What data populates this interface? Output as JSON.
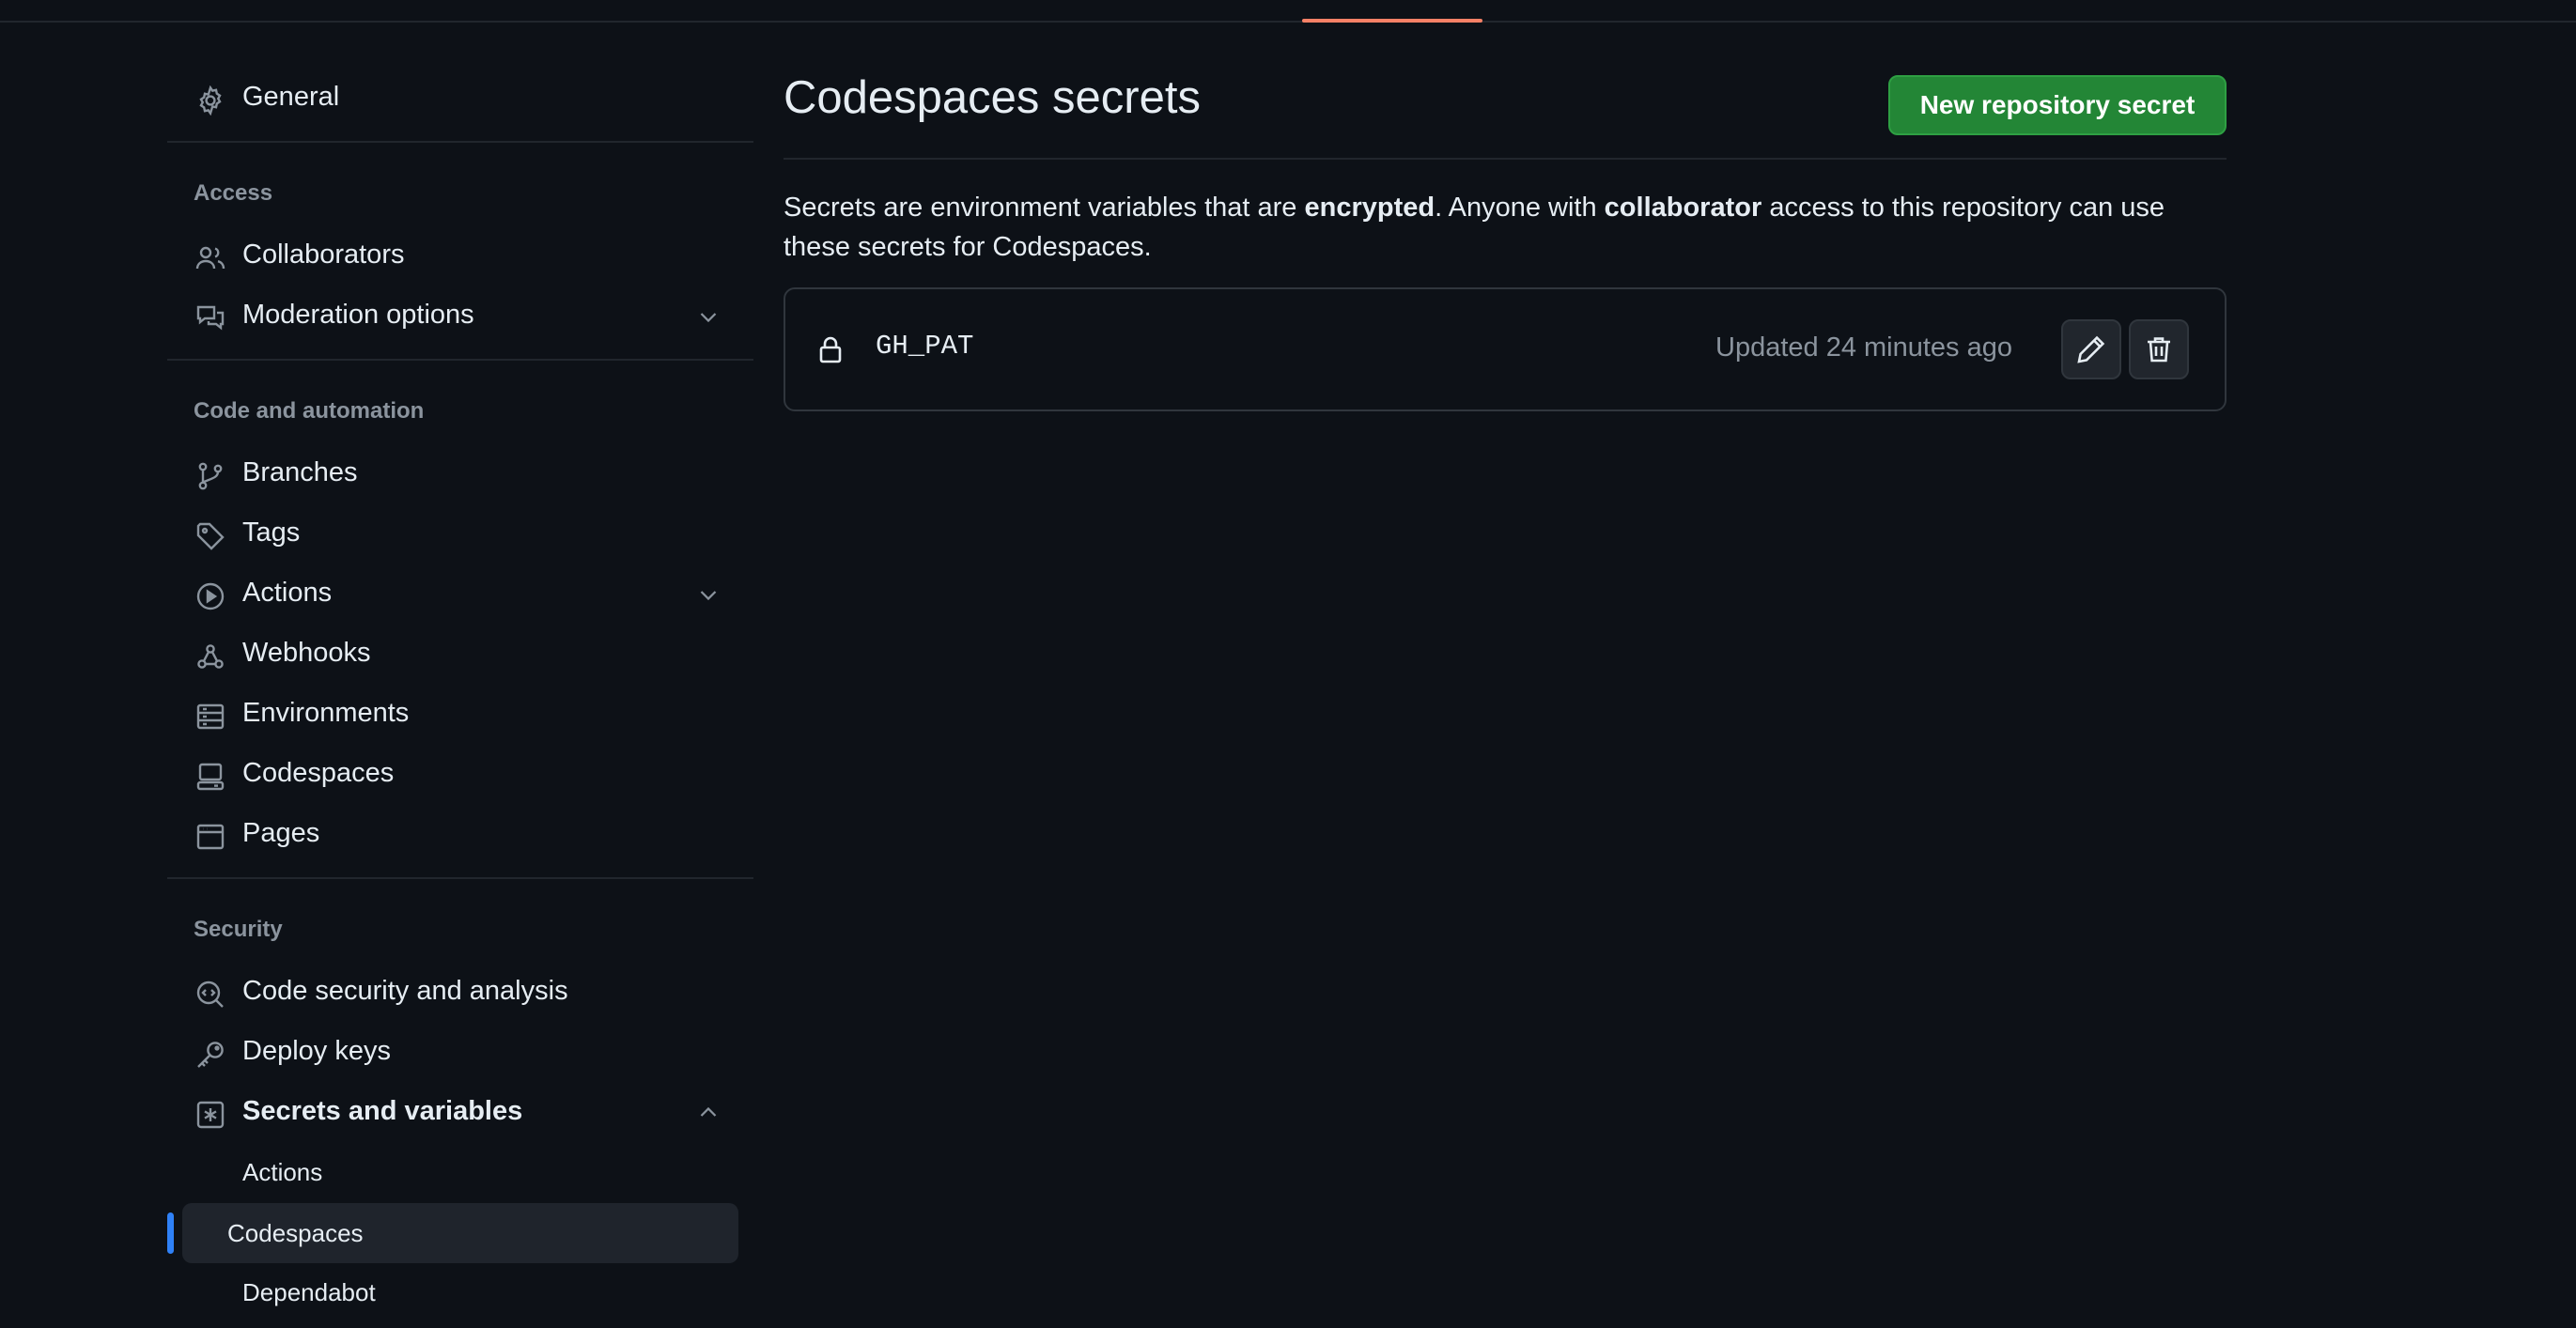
{
  "sidebar": {
    "general": "General",
    "sections": {
      "access": "Access",
      "code_automation": "Code and automation",
      "security": "Security"
    },
    "items": {
      "collaborators": "Collaborators",
      "moderation": "Moderation options",
      "branches": "Branches",
      "tags": "Tags",
      "actions": "Actions",
      "webhooks": "Webhooks",
      "environments": "Environments",
      "codespaces": "Codespaces",
      "pages": "Pages",
      "code_security": "Code security and analysis",
      "deploy_keys": "Deploy keys",
      "secrets": "Secrets and variables"
    },
    "sub_items": {
      "actions": "Actions",
      "codespaces": "Codespaces",
      "dependabot": "Dependabot"
    },
    "active_sub_item": "Codespaces"
  },
  "main": {
    "title": "Codespaces secrets",
    "new_button": "New repository secret",
    "description": {
      "part1": "Secrets are environment variables that are ",
      "bold1": "encrypted",
      "part2": ". Anyone with ",
      "bold2": "collaborator",
      "part3": " access to this repository can use these secrets for Codespaces."
    },
    "secrets": [
      {
        "name": "GH_PAT",
        "updated": "Updated 24 minutes ago"
      }
    ]
  },
  "colors": {
    "background": "#0d1117",
    "text": "#e6edf3",
    "muted": "#8b949e",
    "border": "#30363d",
    "button_green": "#238636",
    "accent_blue": "#2f81f7",
    "tab_underline": "#f78166"
  },
  "icons": {
    "general": "gear-icon",
    "collaborators": "people-icon",
    "moderation": "comment-discussion-icon",
    "branches": "git-branch-icon",
    "tags": "tag-icon",
    "actions": "play-icon",
    "webhooks": "webhook-icon",
    "environments": "server-icon",
    "codespaces": "codespaces-icon",
    "pages": "browser-icon",
    "code_security": "codescan-icon",
    "deploy_keys": "key-icon",
    "secrets": "key-asterisk-icon",
    "secret_row": "lock-icon",
    "edit": "pencil-icon",
    "delete": "trash-icon"
  }
}
